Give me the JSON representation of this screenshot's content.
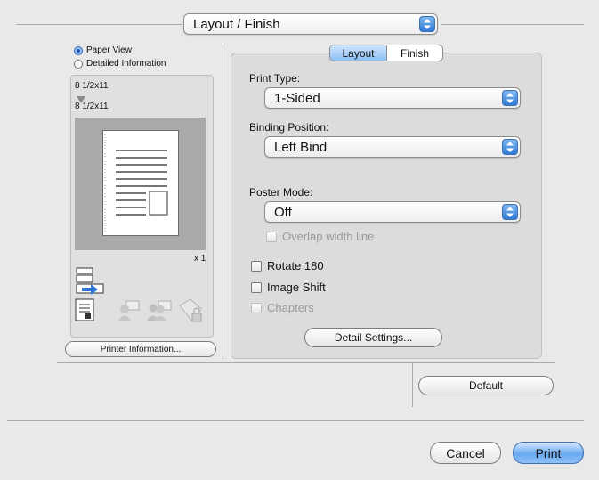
{
  "panel_selector": {
    "label": "Layout / Finish"
  },
  "view_options": [
    {
      "label": "Paper View",
      "selected": true
    },
    {
      "label": "Detailed Information",
      "selected": false
    }
  ],
  "preview": {
    "original_size": "8 1/2x11",
    "output_size": "8 1/2x11",
    "copies": "x 1"
  },
  "printer_info_button": "Printer Information...",
  "tabs": [
    {
      "label": "Layout",
      "active": true
    },
    {
      "label": "Finish",
      "active": false
    }
  ],
  "print_type": {
    "label": "Print Type:",
    "value": "1-Sided"
  },
  "binding_position": {
    "label": "Binding Position:",
    "value": "Left Bind"
  },
  "poster_mode": {
    "label": "Poster Mode:",
    "value": "Off"
  },
  "checkboxes": {
    "overlap_width_line": {
      "label": "Overlap width line",
      "checked": false,
      "enabled": false
    },
    "rotate_180": {
      "label": "Rotate 180",
      "checked": false,
      "enabled": true
    },
    "image_shift": {
      "label": "Image Shift",
      "checked": false,
      "enabled": true
    },
    "chapters": {
      "label": "Chapters",
      "checked": false,
      "enabled": false
    }
  },
  "detail_settings_button": "Detail Settings...",
  "default_button": "Default",
  "cancel_button": "Cancel",
  "print_button": "Print",
  "colors": {
    "accent": "#3b82e6",
    "selected_segment": "#8cc0f3"
  },
  "icons": [
    "up-down-arrows-icon",
    "output-tray-icon",
    "document-icon",
    "user-settings-icon",
    "users-icon",
    "secure-folder-icon"
  ]
}
